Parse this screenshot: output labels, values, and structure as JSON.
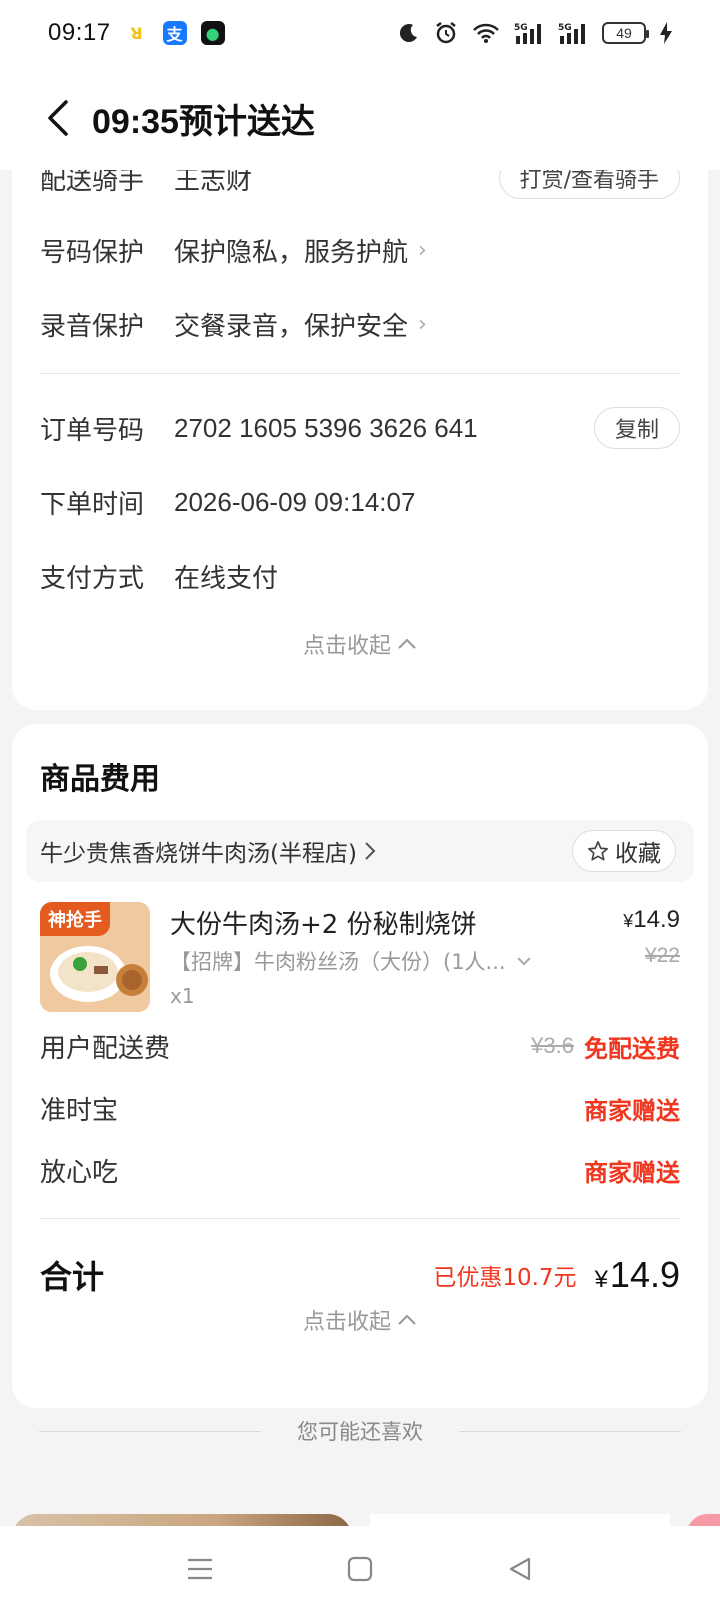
{
  "status_bar": {
    "time": "09:17",
    "battery": "49"
  },
  "nav": {
    "title": "09:35预计送达"
  },
  "delivery_info": {
    "rider_label": "配送骑手",
    "rider_name": "王志财",
    "rider_action": "打赏/查看骑手",
    "phone_label": "号码保护",
    "phone_value": "保护隐私，服务护航",
    "record_label": "录音保护",
    "record_value": "交餐录音，保护安全",
    "order_no_label": "订单号码",
    "order_no": "2702 1605 5396 3626 641",
    "copy_label": "复制",
    "order_time_label": "下单时间",
    "order_time": "2026-06-09 09:14:07",
    "payment_label": "支付方式",
    "payment_value": "在线支付",
    "collapse_label": "点击收起"
  },
  "fees": {
    "title": "商品费用",
    "shop_name": "牛少贵焦香烧饼牛肉汤(半程店)",
    "favorite_label": "收藏",
    "item": {
      "tag": "神抢手",
      "name": "大份牛肉汤+2 份秘制烧饼",
      "desc": "【招牌】牛肉粉丝汤（大份）(1人...",
      "qty": "x1",
      "price_symbol": "¥",
      "price": "14.9",
      "original_price": "¥22"
    },
    "delivery_fee_label": "用户配送费",
    "delivery_fee_original": "¥3.6",
    "delivery_fee_value": "免配送费",
    "ontime_label": "准时宝",
    "ontime_value": "商家赠送",
    "safe_label": "放心吃",
    "safe_value": "商家赠送",
    "total_label": "合计",
    "saved_text": "已优惠10.7元",
    "total_symbol": "¥",
    "total_value": "14.9",
    "collapse_label": "点击收起"
  },
  "recommend": {
    "label": "您可能还喜欢"
  },
  "colors": {
    "accent_red": "#f0361f",
    "page_bg": "#f4f4f4"
  }
}
